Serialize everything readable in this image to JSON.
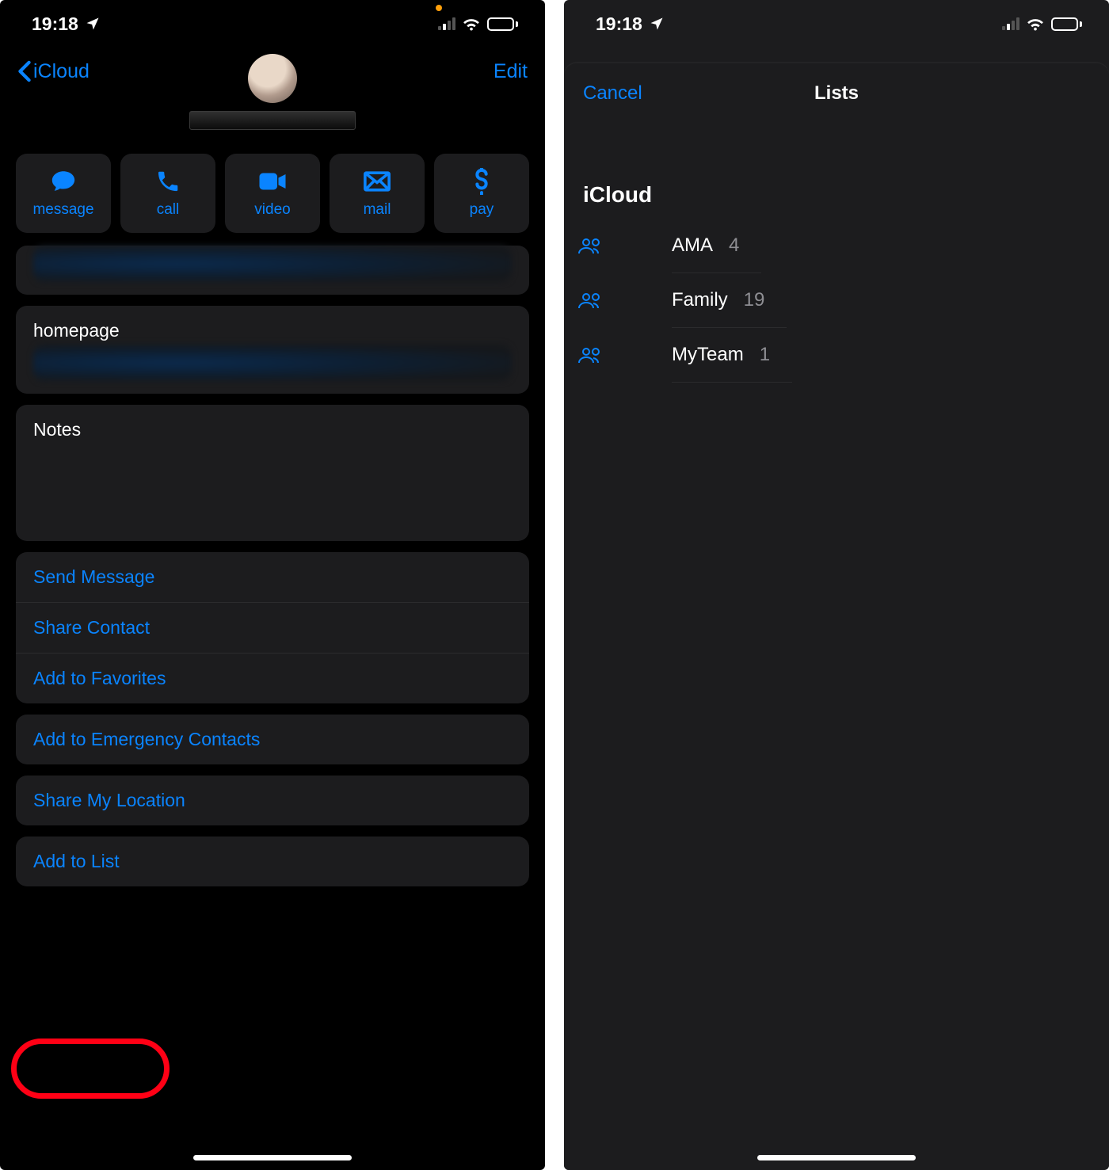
{
  "status": {
    "time": "19:18"
  },
  "left": {
    "back_label": "iCloud",
    "edit_label": "Edit",
    "actions": {
      "message": "message",
      "call": "call",
      "video": "video",
      "mail": "mail",
      "pay": "pay"
    },
    "homepage_label": "homepage",
    "notes_label": "Notes",
    "menu": {
      "send_message": "Send Message",
      "share_contact": "Share Contact",
      "add_favorites": "Add to Favorites",
      "add_emergency": "Add to Emergency Contacts",
      "share_location": "Share My Location",
      "add_to_list": "Add to List"
    }
  },
  "right": {
    "cancel": "Cancel",
    "title": "Lists",
    "section": "iCloud",
    "items": [
      {
        "name": "AMA",
        "count": "4"
      },
      {
        "name": "Family",
        "count": "19"
      },
      {
        "name": "MyTeam",
        "count": "1"
      }
    ]
  }
}
